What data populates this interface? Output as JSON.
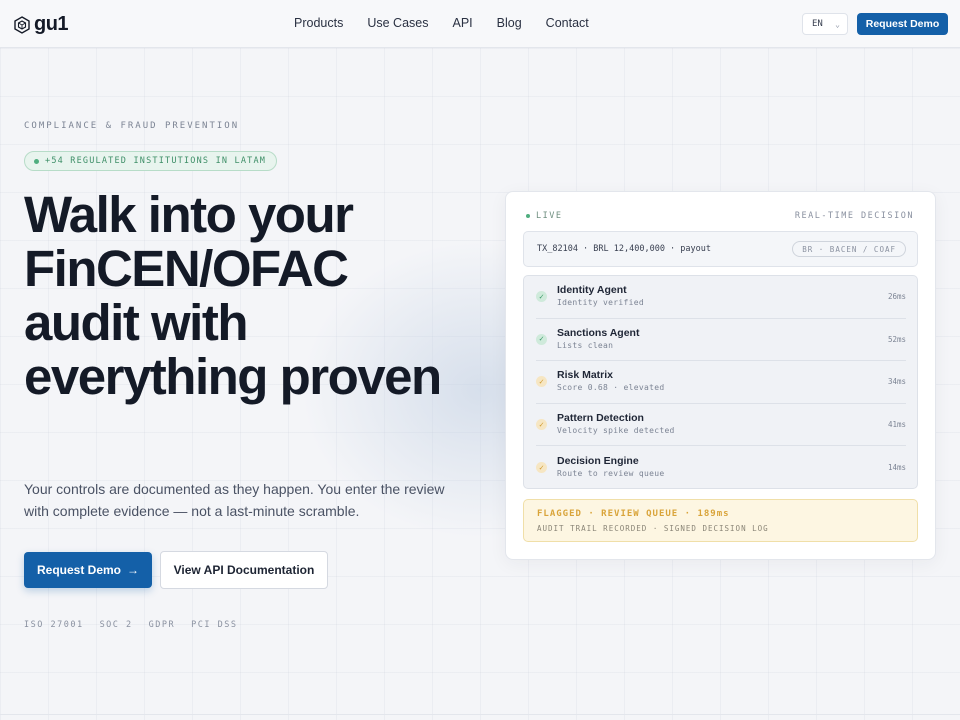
{
  "header": {
    "logo_text": "gu1",
    "logo_icon": "cube-icon",
    "nav": [
      "Products",
      "Use Cases",
      "API",
      "Blog",
      "Contact"
    ],
    "lang": "EN",
    "demo_button": "Request Demo"
  },
  "hero": {
    "eyebrow": "COMPLIANCE & FRAUD PREVENTION",
    "badge": "+54 REGULATED INSTITUTIONS IN LATAM",
    "headline": "Walk into your FinCEN/OFAC audit with everything proven",
    "subtext": "Your controls are documented as they happen. You enter the review with complete evidence — not a last-minute scramble.",
    "primary_button": "Request Demo",
    "primary_arrow": "→",
    "secondary_button": "View API Documentation",
    "certs": [
      "ISO 27001",
      "SOC 2",
      "GDPR",
      "PCI DSS"
    ]
  },
  "decision_card": {
    "live_label": "LIVE",
    "mode_label": "REAL-TIME DECISION",
    "transaction": "TX_82104 · BRL 12,400,000 · payout",
    "jurisdiction_tag": "BR · BACEN / COAF",
    "agents": [
      {
        "name": "Identity Agent",
        "status": "Identity verified",
        "ms": "26ms",
        "state": "ok"
      },
      {
        "name": "Sanctions Agent",
        "status": "Lists clean",
        "ms": "52ms",
        "state": "ok"
      },
      {
        "name": "Risk Matrix",
        "status": "Score 0.68 · elevated",
        "ms": "34ms",
        "state": "warn"
      },
      {
        "name": "Pattern Detection",
        "status": "Velocity spike detected",
        "ms": "41ms",
        "state": "warn"
      },
      {
        "name": "Decision Engine",
        "status": "Route to review queue",
        "ms": "14ms",
        "state": "warn"
      }
    ],
    "result_title": "FLAGGED · REVIEW QUEUE · 189ms",
    "result_sub": "AUDIT TRAIL RECORDED · SIGNED DECISION LOG"
  },
  "colors": {
    "brand": "#1460a8",
    "ok": "#3b9a6a",
    "warn": "#d9a43a"
  }
}
